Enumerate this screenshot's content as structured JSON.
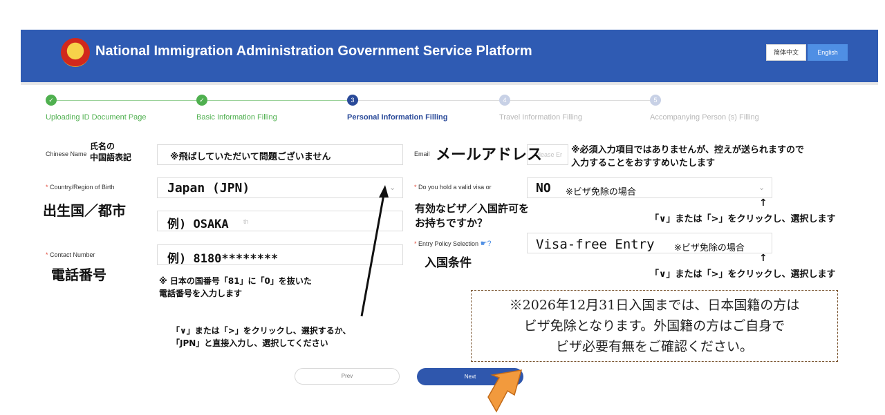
{
  "header": {
    "title": "National Immigration Administration Government Service Platform",
    "lang_zh": "简体中文",
    "lang_en": "English"
  },
  "steps": [
    {
      "num": "✓",
      "label": "Uploading ID Document Page",
      "state": "done"
    },
    {
      "num": "✓",
      "label": "Basic Information Filling",
      "state": "done"
    },
    {
      "num": "3",
      "label": "Personal Information Filling",
      "state": "active"
    },
    {
      "num": "4",
      "label": "Travel Information Filling",
      "state": "todo"
    },
    {
      "num": "5",
      "label": "Accompanying Person (s) Filling",
      "state": "todo"
    }
  ],
  "form": {
    "chinese_name_label": "Chinese Name",
    "chinese_name_value": "※飛ばしていただいて問題ございません",
    "email_label": "Email",
    "email_placeholder": "Please Er",
    "country_label": "Country/Region of Birth",
    "country_value": "Japan (JPN)",
    "city_value": "例) OSAKA",
    "city_placeholder": "th",
    "contact_label": "Contact Number",
    "contact_value": "例) 8180********",
    "visa_label": "Do you hold a valid visa or",
    "visa_value": "NO",
    "visa_note": "※ビザ免除の場合",
    "entry_policy_label": "Entry Policy Selection",
    "entry_policy_value": "Visa-free Entry",
    "entry_policy_note": "※ビザ免除の場合"
  },
  "annotations": {
    "chinese_name_jp": "氏名の\n中国語表記",
    "email_jp": "メールアドレス",
    "email_note": "※必須入力項目ではありませんが、控えが送られますので\n入力することをおすすめいたします",
    "birth_jp": "出生国／都市",
    "phone_jp": "電話番号",
    "phone_note": "※ 日本の国番号「81」に「0」を抜いた\n電話番号を入力します",
    "country_select_note": "「∨」または「>」をクリックし、選択するか、\n「JPN」と直接入力し、選択してください",
    "visa_jp": "有効なビザ／入国許可を\nお持ちですか？",
    "entry_jp": "入国条件",
    "select_note_1": "「∨」または「>」をクリックし、選択します",
    "select_note_2": "「∨」または「>」をクリックし、選択します",
    "up_arrow": "↑"
  },
  "notice": {
    "line1": "※2026年12月31日入国までは、日本国籍の方は",
    "line2": "ビザ免除となります。外国籍の方はご自身で",
    "line3": "ビザ必要有無をご確認ください。"
  },
  "buttons": {
    "prev": "Prev",
    "next": "Next"
  },
  "colors": {
    "header": "#2f5bb3",
    "done": "#4fb04f",
    "active": "#2a4a99",
    "arrow": "#f29a3d"
  }
}
